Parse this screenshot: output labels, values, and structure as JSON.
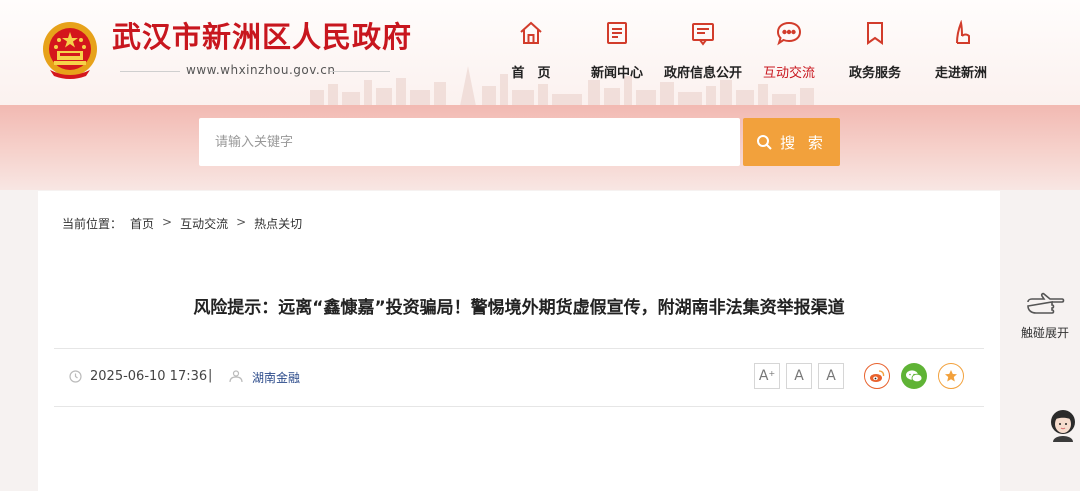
{
  "site": {
    "title": "武汉市新洲区人民政府",
    "url": "www.whxinzhou.gov.cn"
  },
  "nav": {
    "items": [
      {
        "label": "首　页",
        "icon": "home-icon"
      },
      {
        "label": "新闻中心",
        "icon": "news-icon"
      },
      {
        "label": "政府信息公开",
        "icon": "info-disclosure-icon"
      },
      {
        "label": "互动交流",
        "icon": "chat-bubble-icon",
        "active": true
      },
      {
        "label": "政务服务",
        "icon": "bookmark-icon"
      },
      {
        "label": "走进新洲",
        "icon": "landmark-icon"
      }
    ]
  },
  "search": {
    "placeholder": "请输入关键字",
    "button_label": "搜 索"
  },
  "breadcrumb": {
    "prefix": "当前位置：",
    "items": [
      "首页",
      "互动交流",
      "热点关切"
    ],
    "separator": ">"
  },
  "article": {
    "title": "风险提示：远离“鑫慷嘉”投资骗局！警惕境外期货虚假宣传，附湖南非法集资举报渠道",
    "date": "2025-06-10 17:36",
    "divider": "|",
    "source": "湖南金融"
  },
  "font_controls": {
    "larger": "A",
    "medium": "A",
    "smaller": "A"
  },
  "share": {
    "icons": [
      "weibo-icon",
      "wechat-icon",
      "favorite-star-icon"
    ]
  },
  "side": {
    "touch_label": "触碰展开"
  },
  "colors": {
    "brand_red": "#c8161e",
    "search_orange": "#f2a13c",
    "source_link": "#2b4a8a"
  }
}
